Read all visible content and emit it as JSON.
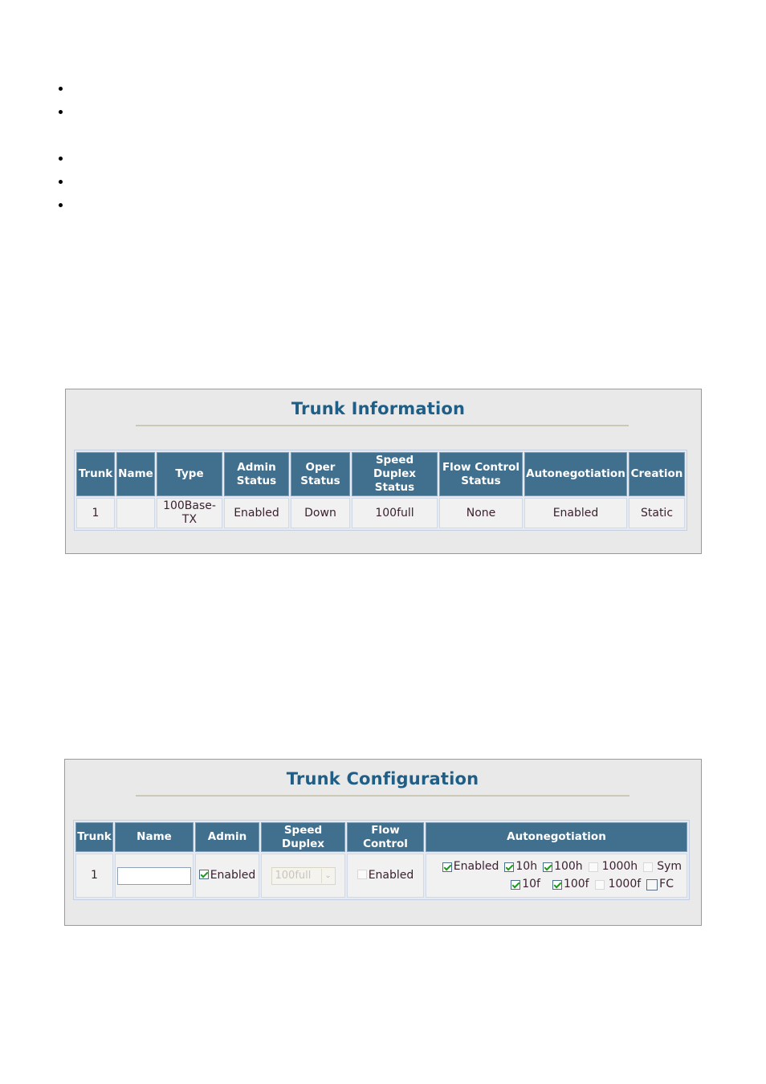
{
  "bullets": [
    {
      "text": ""
    },
    {
      "text": ""
    },
    {
      "text": ""
    },
    {
      "text": ""
    },
    {
      "text": ""
    }
  ],
  "trunk_information": {
    "title": "Trunk Information",
    "columns": [
      "Trunk",
      "Name",
      "Type",
      "Admin Status",
      "Oper Status",
      "Speed Duplex Status",
      "Flow Control Status",
      "Autonegotiation",
      "Creation"
    ],
    "header_lines": [
      [
        "Trunk"
      ],
      [
        "Name"
      ],
      [
        "Type"
      ],
      [
        "Admin",
        "Status"
      ],
      [
        "Oper",
        "Status"
      ],
      [
        "Speed",
        "Duplex",
        "Status"
      ],
      [
        "Flow Control",
        "Status"
      ],
      [
        "Autonegotiation"
      ],
      [
        "Creation"
      ]
    ],
    "rows": [
      {
        "trunk": "1",
        "name": "",
        "type_line1": "100Base-",
        "type_line2": "TX",
        "admin_status": "Enabled",
        "oper_status": "Down",
        "speed_duplex_status": "100full",
        "flow_control_status": "None",
        "autonegotiation": "Enabled",
        "creation": "Static"
      }
    ]
  },
  "trunk_configuration": {
    "title": "Trunk Configuration",
    "header_lines": [
      [
        "Trunk"
      ],
      [
        "Name"
      ],
      [
        "Admin"
      ],
      [
        "Speed",
        "Duplex"
      ],
      [
        "Flow",
        "Control"
      ],
      [
        "Autonegotiation"
      ]
    ],
    "rows": [
      {
        "trunk": "1",
        "name_value": "",
        "admin": {
          "label": "Enabled",
          "checked": true
        },
        "speed_duplex": {
          "selected": "100full",
          "disabled": true
        },
        "flow_control": {
          "label": "Enabled",
          "checked": false
        },
        "autonegotiation": {
          "enabled": {
            "label": "Enabled",
            "checked": true
          },
          "row1": [
            {
              "label": "10h",
              "checked": true
            },
            {
              "label": "100h",
              "checked": true
            },
            {
              "label": "1000h",
              "checked": false
            },
            {
              "label": "Sym",
              "checked": false
            }
          ],
          "row2": [
            {
              "label": "10f",
              "checked": true
            },
            {
              "label": "100f",
              "checked": true
            },
            {
              "label": "1000f",
              "checked": false
            },
            {
              "label": "FC",
              "checked": false
            }
          ]
        }
      }
    ]
  },
  "colors": {
    "panel_bg": "#e9e9e9",
    "title": "#1f5e86",
    "header_bg": "#41708f",
    "cell_bg": "#f1f1f1",
    "check": "#1b9a1b"
  }
}
